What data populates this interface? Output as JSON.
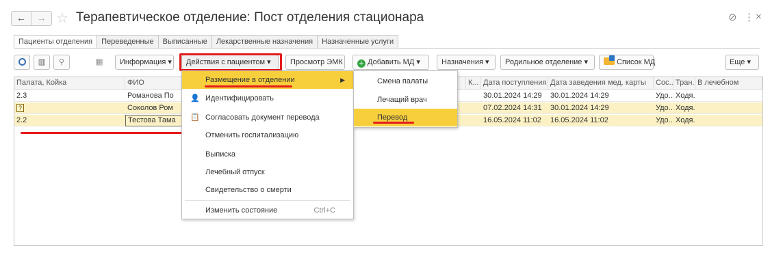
{
  "window": {
    "title": "Терапевтическое отделение: Пост отделения стационара",
    "back_symbol": "←",
    "forward_symbol": "→",
    "star_symbol": "☆",
    "link_symbol": "⊘",
    "menu_symbol": "⋮",
    "close_symbol": "×"
  },
  "tabs": [
    {
      "label": "Пациенты отделения",
      "active": true
    },
    {
      "label": "Переведенные"
    },
    {
      "label": "Выписанные"
    },
    {
      "label": "Лекарственные назначения"
    },
    {
      "label": "Назначенные услуги"
    }
  ],
  "toolbar": {
    "info_label": "Информация ▾",
    "actions_label": "Действия с пациентом ▾",
    "emk_label": "Просмотр ЭМК",
    "add_md_label": "Добавить МД ▾",
    "assignments_label": "Назначения ▾",
    "maternity_label": "Родильное отделение ▾",
    "md_list_label": "Список МД",
    "more_label": "Еще ▾",
    "add_symbol": "+"
  },
  "grid": {
    "columns": [
      "Палата, Койка",
      "ФИО",
      "К...",
      "Дата поступления",
      "Дата заведения мед. карты",
      "Сос...",
      "Тран...",
      "В лечебном"
    ],
    "rows": [
      {
        "bed": "2.3",
        "name": "Романова По",
        "admission": "30.01.2024 14:29",
        "card_date": "30.01.2024 14:29",
        "state": "Удо...",
        "transport": "Ходя..."
      },
      {
        "bed": "?",
        "name": "Соколов Ром",
        "admission": "07.02.2024 14:31",
        "card_date": "30.01.2024 14:29",
        "state": "Удо...",
        "transport": "Ходя..."
      },
      {
        "bed": "2.2",
        "name": "Тестова Тама",
        "admission": "16.05.2024 11:02",
        "card_date": "16.05.2024 11:02",
        "state": "Удо...",
        "transport": "Ходя..."
      }
    ]
  },
  "context_menu": {
    "items": [
      {
        "label": "Размещение в отделении",
        "active": true,
        "arrow": "▶"
      },
      {
        "label": "Идентифицировать",
        "icon_char": "👤"
      },
      {
        "label": "Согласовать документ перевода",
        "icon_char": "📋"
      },
      {
        "label": "Отменить госпитализацию"
      },
      {
        "label": "Выписка"
      },
      {
        "label": "Лечебный отпуск"
      },
      {
        "label": "Свидетельство о смерти"
      },
      {
        "label": "Изменить состояние",
        "shortcut": "Ctrl+C"
      }
    ]
  },
  "submenu": {
    "items": [
      {
        "label": "Смена палаты"
      },
      {
        "label": "Лечащий врач"
      },
      {
        "label": "Перевод",
        "active": true
      }
    ]
  },
  "colors": {
    "highlight_red": "#e41b1b",
    "menu_active": "#f7cf3d",
    "row_yellow": "#fbf1c4"
  }
}
